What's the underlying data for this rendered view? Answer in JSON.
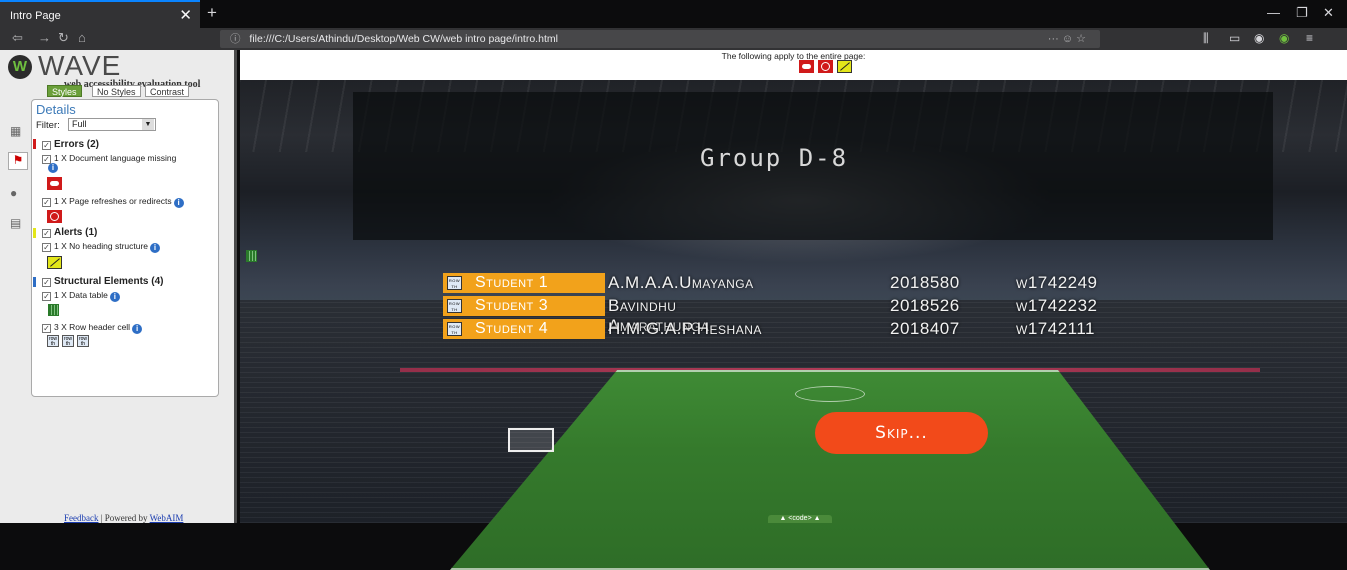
{
  "browser": {
    "tab_title": "Intro Page",
    "tab_close": "✕",
    "new_tab": "+",
    "url": "file:///C:/Users/Athindu/Desktop/Web CW/web intro page/intro.html",
    "url_more": "··· ☺ ☆",
    "accent": "#0a84ff"
  },
  "wave": {
    "logo": "WAVE",
    "tagline": "web accessibility evaluation tool",
    "views": [
      "Styles",
      "No Styles",
      "Contrast"
    ],
    "details_title": "Details",
    "filter_label": "Filter:",
    "filter_value": "Full",
    "errors": {
      "title": "Errors (2)",
      "items": [
        "1 X Document language missing",
        "1 X Page refreshes or redirects"
      ]
    },
    "alerts": {
      "title": "Alerts (1)",
      "items": [
        "1 X No heading structure"
      ]
    },
    "structural": {
      "title": "Structural Elements (4)",
      "items": [
        "1 X Data table",
        "3 X Row header cell"
      ]
    },
    "footer_feedback": "Feedback",
    "footer_sep": " | Powered by ",
    "footer_webaim": "WebAIM",
    "colors": {
      "error": "#d01a1a",
      "alert": "#e3e61a",
      "structure": "#2e6ec5",
      "brand_green": "#6a9f3a"
    }
  },
  "page": {
    "apply_text": "The following apply to the entire page:",
    "group_title": "Group D-8",
    "students": [
      {
        "label": "Student 1",
        "name": "A.M.A.A.Umayanga",
        "id": "2018580",
        "w": "w1742249"
      },
      {
        "label": "Student 3",
        "name": "Bavindhu Amarathunga",
        "id": "2018526",
        "w": "w1742232"
      },
      {
        "label": "Student 4",
        "name": "H.M.G.A.P.Heshana",
        "id": "2018407",
        "w": "w1742111"
      }
    ],
    "skip_label": "Skip...",
    "code_tab": "▲ <code> ▲",
    "label_color": "#f2a21b",
    "skip_color": "#f24a1a"
  }
}
